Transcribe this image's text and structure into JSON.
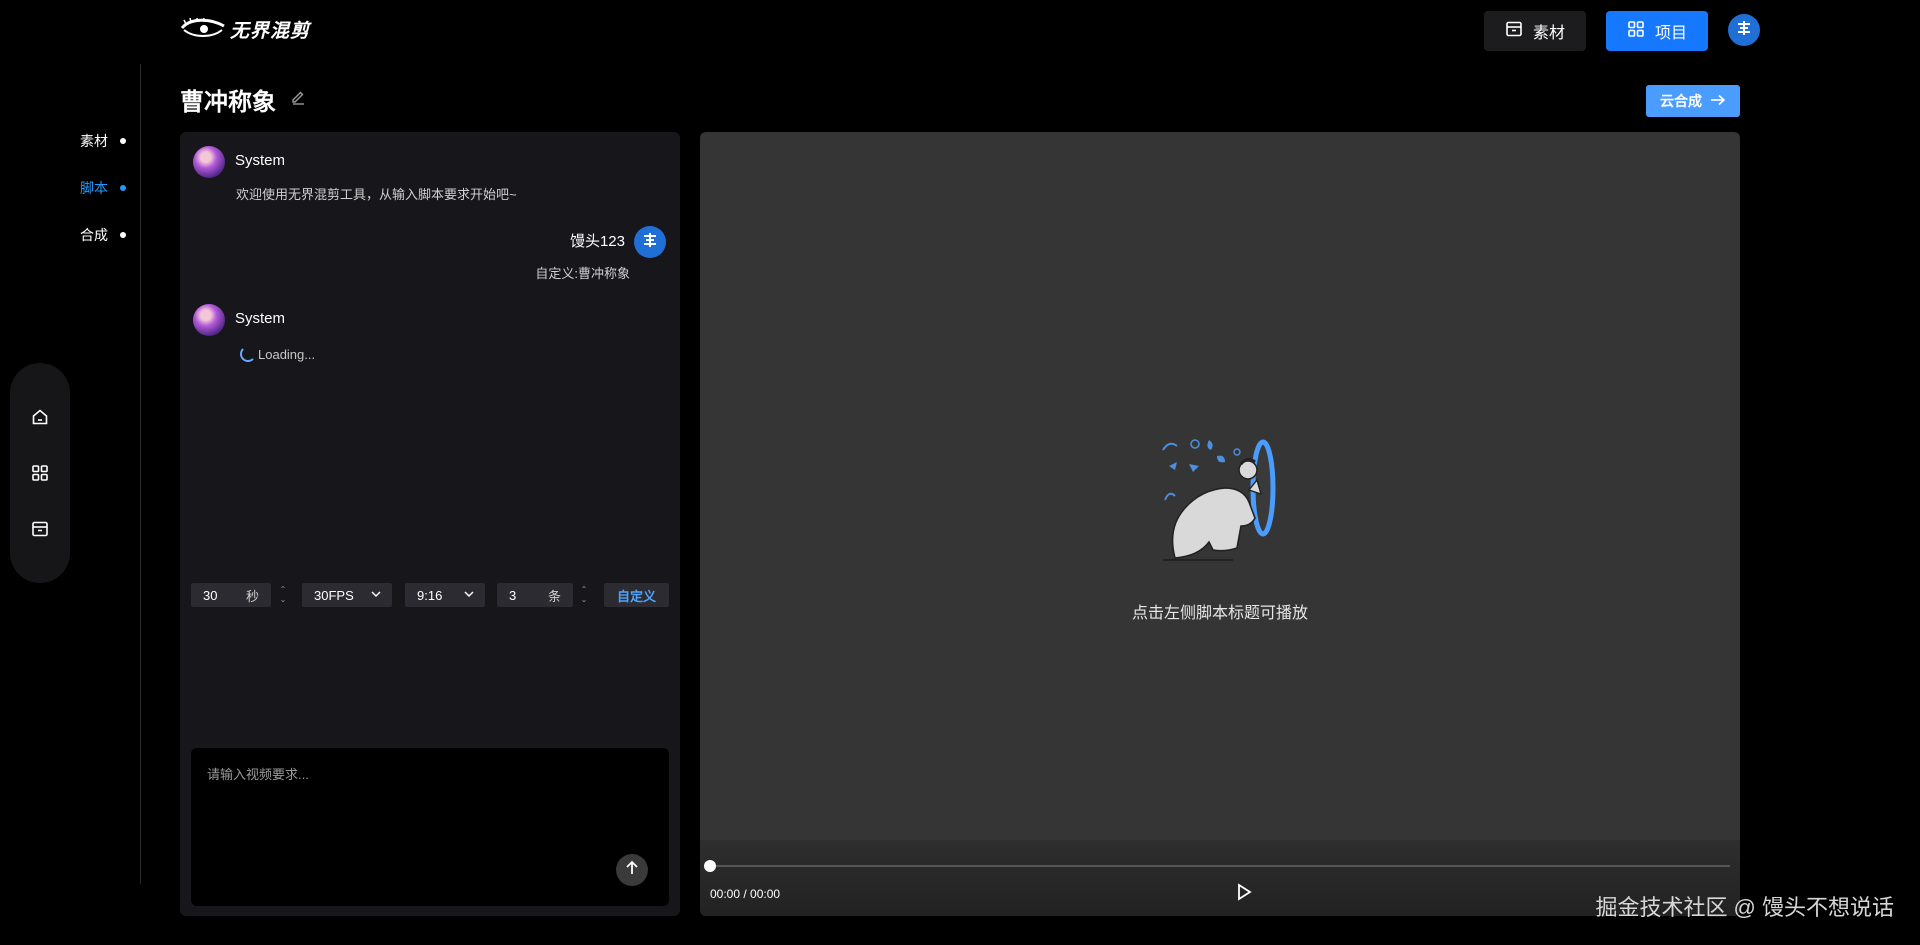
{
  "header": {
    "logo_text": "无界混剪",
    "materials_label": "素材",
    "projects_label": "项目",
    "icons": {
      "materials": "archive-box-icon",
      "projects": "grid-icon",
      "avatar": "user-avatar-icon"
    }
  },
  "steps": [
    {
      "label": "素材",
      "active": false
    },
    {
      "label": "脚本",
      "active": true
    },
    {
      "label": "合成",
      "active": false
    }
  ],
  "dock": {
    "icons": [
      "home-icon",
      "grid-icon",
      "archive-box-icon"
    ]
  },
  "page": {
    "title": "曹冲称象",
    "cloud_button": "云合成"
  },
  "chat": {
    "messages": [
      {
        "sender": "System",
        "text": "欢迎使用无界混剪工具，从输入脚本要求开始吧~"
      },
      {
        "sender": "馒头123",
        "text": "自定义:曹冲称象"
      },
      {
        "sender": "System",
        "text": "Loading..."
      }
    ],
    "controls": {
      "duration_value": "30",
      "duration_unit": "秒",
      "fps_value": "30FPS",
      "ratio_value": "9:16",
      "count_value": "3",
      "count_unit": "条",
      "custom_label": "自定义"
    },
    "prompt_placeholder": "请输入视频要求..."
  },
  "video": {
    "empty_caption": "点击左侧脚本标题可播放",
    "time": "00:00 / 00:00",
    "progress_fraction": 0
  },
  "watermark": "掘金技术社区 @ 馒头不想说话",
  "colors": {
    "accent": "#1677ff",
    "active_step": "#1e9bff",
    "cloud_button": "#4a9dff",
    "panel_bg": "#16161b",
    "video_bg": "#353535"
  }
}
